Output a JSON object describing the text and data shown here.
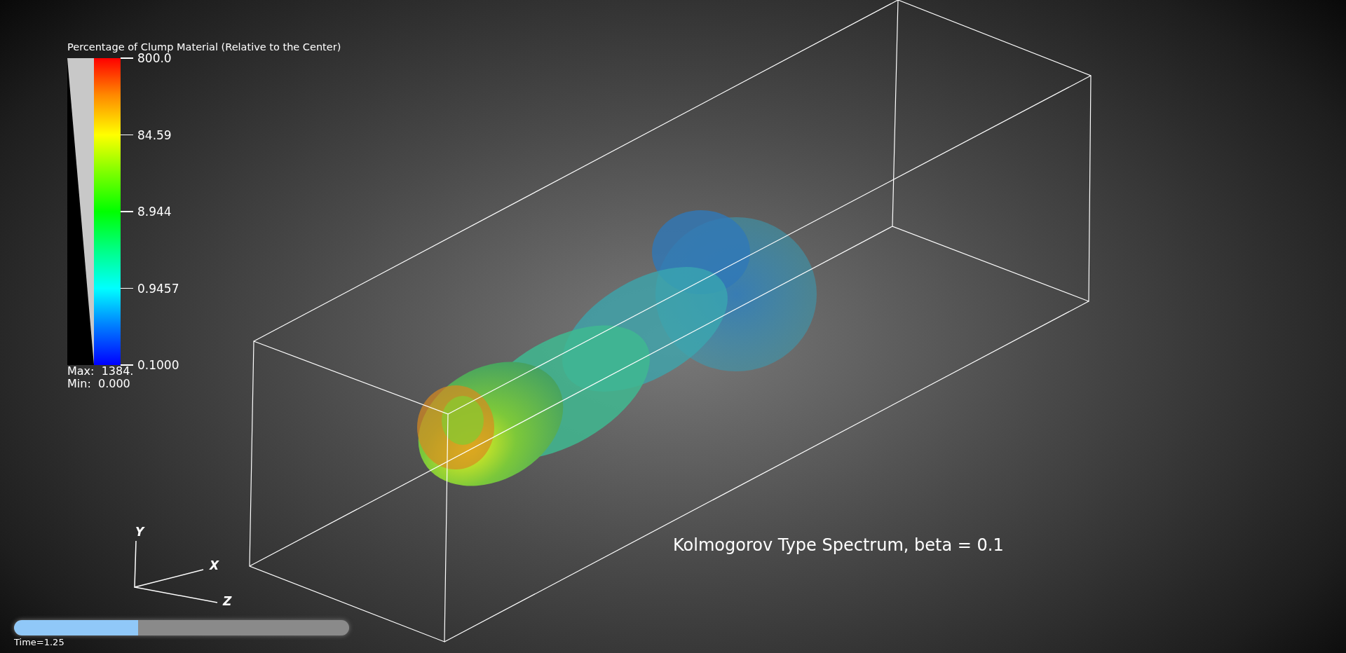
{
  "legend": {
    "title": "Percentage of Clump Material (Relative to the Center)",
    "ticks": [
      "800.0",
      "84.59",
      "8.944",
      "0.9457",
      "0.1000"
    ],
    "max": "Max:  1384.",
    "min": "Min:  0.000"
  },
  "annotation": "Kolmogorov Type Spectrum, beta = 0.1",
  "axes": {
    "x": "X",
    "y": "Y",
    "z": "Z"
  },
  "time_slider": {
    "label": "Time=1.25",
    "level": 0.37
  }
}
